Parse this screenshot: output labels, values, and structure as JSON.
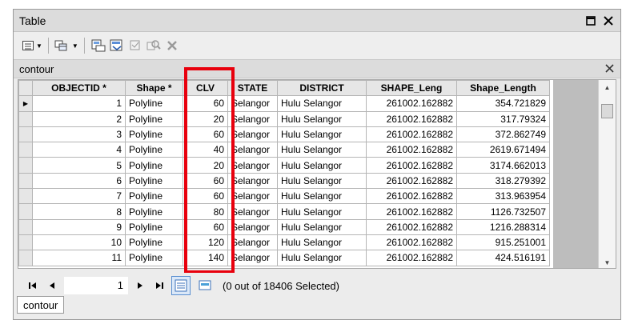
{
  "window": {
    "title": "Table"
  },
  "titlebar_controls": {
    "restore_icon": "restore-icon",
    "close_icon": "close-icon"
  },
  "toolbar": {
    "icons": [
      "table-options-icon",
      "related-tables-icon",
      "select-by-attributes-icon",
      "switch-selection-icon",
      "clear-selection-icon",
      "zoom-to-selected-icon",
      "delete-selected-icon"
    ]
  },
  "layer_tab": {
    "label": "contour"
  },
  "table": {
    "columns": [
      "OBJECTID *",
      "Shape *",
      "CLV",
      "STATE",
      "DISTRICT",
      "SHAPE_Leng",
      "Shape_Length"
    ],
    "rows": [
      [
        "1",
        "Polyline",
        "60",
        "Selangor",
        "Hulu Selangor",
        "261002.162882",
        "354.721829"
      ],
      [
        "2",
        "Polyline",
        "20",
        "Selangor",
        "Hulu Selangor",
        "261002.162882",
        "317.79324"
      ],
      [
        "3",
        "Polyline",
        "60",
        "Selangor",
        "Hulu Selangor",
        "261002.162882",
        "372.862749"
      ],
      [
        "4",
        "Polyline",
        "40",
        "Selangor",
        "Hulu Selangor",
        "261002.162882",
        "2619.671494"
      ],
      [
        "5",
        "Polyline",
        "20",
        "Selangor",
        "Hulu Selangor",
        "261002.162882",
        "3174.662013"
      ],
      [
        "6",
        "Polyline",
        "60",
        "Selangor",
        "Hulu Selangor",
        "261002.162882",
        "318.279392"
      ],
      [
        "7",
        "Polyline",
        "60",
        "Selangor",
        "Hulu Selangor",
        "261002.162882",
        "313.963954"
      ],
      [
        "8",
        "Polyline",
        "80",
        "Selangor",
        "Hulu Selangor",
        "261002.162882",
        "1126.732507"
      ],
      [
        "9",
        "Polyline",
        "60",
        "Selangor",
        "Hulu Selangor",
        "261002.162882",
        "1216.288314"
      ],
      [
        "10",
        "Polyline",
        "120",
        "Selangor",
        "Hulu Selangor",
        "261002.162882",
        "915.251001"
      ],
      [
        "11",
        "Polyline",
        "140",
        "Selangor",
        "Hulu Selangor",
        "261002.162882",
        "424.516191"
      ]
    ],
    "current_row_marker": "▶"
  },
  "navigation": {
    "current_record": "1",
    "status_text": "(0 out of 18406 Selected)"
  },
  "bottom_tab": {
    "label": "contour"
  },
  "colors": {
    "highlight": "#e8000d"
  }
}
